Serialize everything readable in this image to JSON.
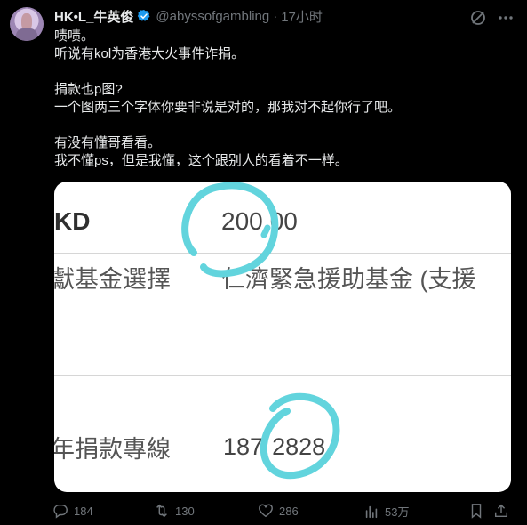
{
  "author": {
    "name": "HK•L_牛英俊",
    "handle": "@abyssofgambling",
    "time": "17小时",
    "separator": "·"
  },
  "tweet": {
    "text": "啧啧。\n听说有kol为香港大火事件诈捐。\n\n捐款也p图?\n一个图两三个字体你要非说是对的，那我对不起你行了吧。\n\n有没有懂哥看看。\n我不懂ps，但是我懂，这个跟别人的看着不一样。"
  },
  "media": {
    "row1_left": "KD",
    "row1_amount": "200",
    "row1_amount_tail": "00",
    "row2_label": "獻基金選擇",
    "row2_value": "仁濟緊急援助基金 (支援",
    "row3_label": "年捐款專線",
    "row3_number_a": "187",
    "row3_number_b": "2828",
    "circle_color": "#62d4dd"
  },
  "actions": {
    "replies": "184",
    "retweets": "130",
    "likes": "286",
    "views": "53万"
  },
  "colors": {
    "accent_verified": "#1d9bf0",
    "muted": "#71767b",
    "text": "#e7e9ea"
  }
}
